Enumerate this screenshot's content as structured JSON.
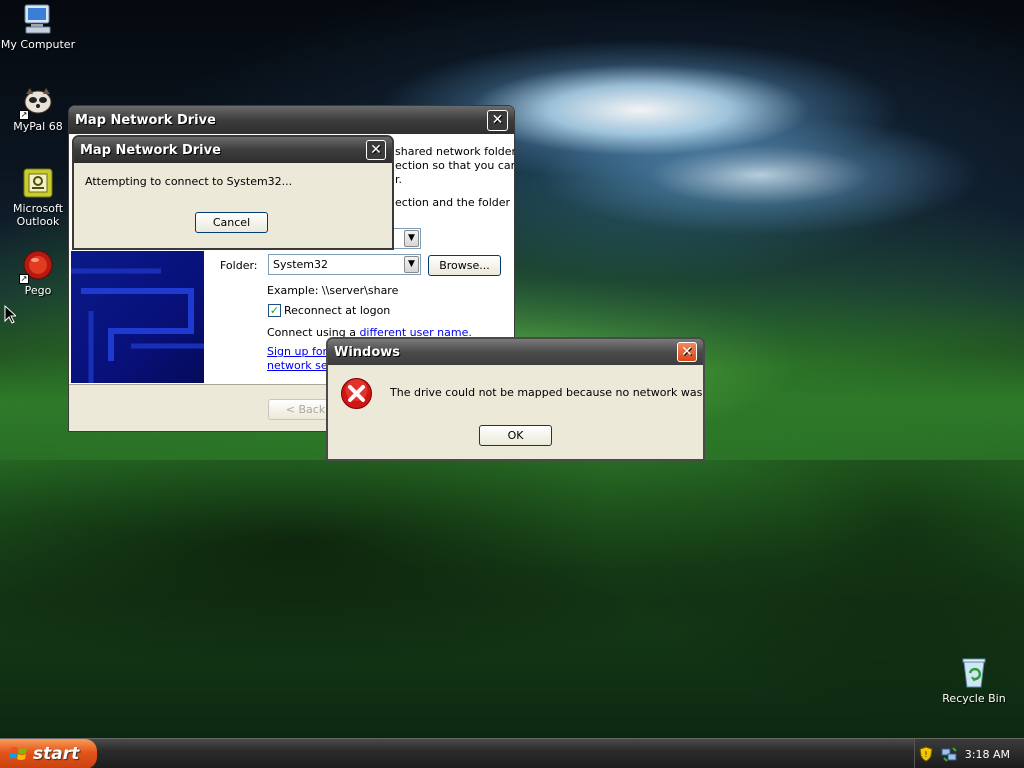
{
  "desktop": {
    "icons": [
      {
        "label": "My Computer"
      },
      {
        "label": "MyPal 68"
      },
      {
        "label": "Microsoft Outlook"
      },
      {
        "label": "Pego"
      },
      {
        "label": "Recycle Bin"
      }
    ]
  },
  "map_drive_window": {
    "title": "Map Network Drive",
    "intro_fragment_1": "shared network folder",
    "intro_fragment_2": "ection so that you can",
    "intro_fragment_3": "r.",
    "intro_fragment_4": "ection and the folder",
    "folder_label": "Folder:",
    "folder_value": "System32",
    "browse_label": "Browse...",
    "example_text": "Example: \\\\server\\share",
    "reconnect_label": "Reconnect at logon",
    "reconnect_checked": true,
    "connect_prefix": "Connect using a ",
    "connect_link": "different user name.",
    "signup_fragment_1": "Sign up for o",
    "signup_fragment_2": "network ser",
    "back_label": "< Back"
  },
  "connect_dialog": {
    "title": "Map Network Drive",
    "message": "Attempting to connect to System32...",
    "cancel_label": "Cancel"
  },
  "error_dialog": {
    "title": "Windows",
    "message": "The drive could not be mapped because no network was found.",
    "ok_label": "OK"
  },
  "taskbar": {
    "start_label": "start",
    "clock": "3:18 AM"
  },
  "colors": {
    "title_active": "#3d3d3d",
    "title_inactive": "#5b5b5b",
    "dialog_face": "#ece9d8",
    "error_red": "#d21414",
    "close_orange": "#e0561c"
  }
}
